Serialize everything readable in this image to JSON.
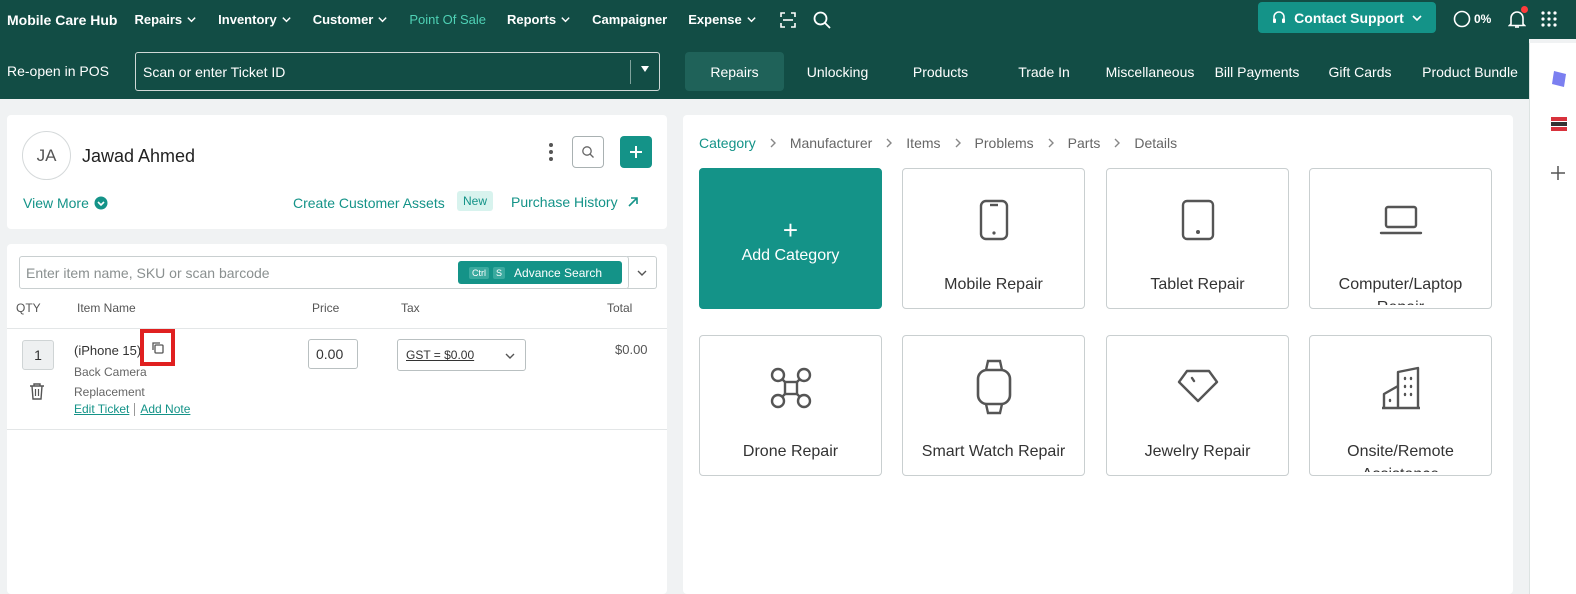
{
  "topbar": {
    "brand": "Mobile Care Hub",
    "nav": [
      {
        "label": "Repairs",
        "dropdown": true
      },
      {
        "label": "Inventory",
        "dropdown": true
      },
      {
        "label": "Customer",
        "dropdown": true
      },
      {
        "label": "Point Of Sale",
        "dropdown": false,
        "active": true
      },
      {
        "label": "Reports",
        "dropdown": true
      },
      {
        "label": "Campaigner",
        "dropdown": false
      },
      {
        "label": "Expense",
        "dropdown": true
      }
    ],
    "icons": [
      "scan-icon",
      "search-icon"
    ],
    "support_label": "Contact Support",
    "progress_value": "0%",
    "accent_color": "#149388",
    "bar_color": "#124d45"
  },
  "subbar": {
    "reopen_label": "Re-open in POS",
    "ticket_placeholder": "Scan or enter Ticket ID",
    "tabs": [
      {
        "label": "Repairs",
        "active": true
      },
      {
        "label": "Unlocking"
      },
      {
        "label": "Products"
      },
      {
        "label": "Trade In"
      },
      {
        "label": "Miscellaneous"
      },
      {
        "label": "Bill Payments"
      },
      {
        "label": "Gift Cards"
      },
      {
        "label": "Product Bundle"
      }
    ]
  },
  "customer": {
    "initials": "JA",
    "name": "Jawad Ahmed",
    "view_more": "View More",
    "create_assets": "Create Customer Assets",
    "new_badge": "New",
    "purchase_history": "Purchase History"
  },
  "cart": {
    "search_placeholder": "Enter item name, SKU or scan barcode",
    "adv_search": {
      "key1": "Ctrl",
      "key2": "S",
      "label": "Advance Search"
    },
    "columns": [
      "QTY",
      "Item Name",
      "Price",
      "Tax",
      "Total"
    ],
    "items": [
      {
        "qty": "1",
        "name": "(iPhone 15)",
        "description": "Back Camera Replacement",
        "edit_ticket": "Edit Ticket",
        "add_note": "Add Note",
        "price": "0.00",
        "tax": "GST = $0.00",
        "total": "$0.00"
      }
    ]
  },
  "catalog": {
    "breadcrumb": [
      "Category",
      "Manufacturer",
      "Items",
      "Problems",
      "Parts",
      "Details"
    ],
    "add_label": "Add Category",
    "categories": [
      {
        "label": "Mobile Repair",
        "icon": "mobile-icon"
      },
      {
        "label": "Tablet Repair",
        "icon": "tablet-icon"
      },
      {
        "label": "Computer/Laptop Repair",
        "icon": "laptop-icon"
      },
      {
        "label": "Drone Repair",
        "icon": "drone-icon"
      },
      {
        "label": "Smart Watch Repair",
        "icon": "smartwatch-icon"
      },
      {
        "label": "Jewelry Repair",
        "icon": "jewelry-icon"
      },
      {
        "label": "Onsite/Remote Assistance",
        "icon": "building-icon"
      }
    ]
  }
}
